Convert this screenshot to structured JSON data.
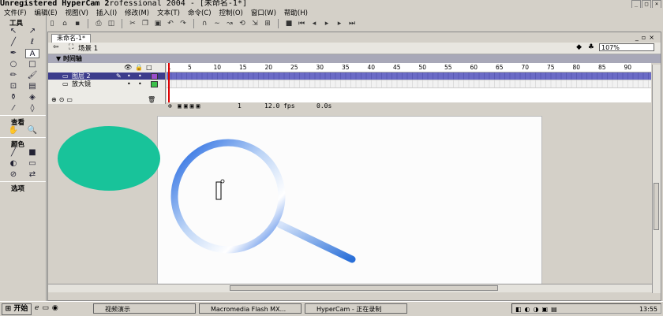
{
  "window": {
    "watermark": "Unregistered HyperCam 2",
    "title_rest": "rofessional 2004 - [未命名-1*]"
  },
  "menu": [
    "文件(F)",
    "编辑(E)",
    "视图(V)",
    "插入(I)",
    "修改(M)",
    "文本(T)",
    "命令(C)",
    "控制(O)",
    "窗口(W)",
    "帮助(H)"
  ],
  "tools_panel": {
    "header": "工具",
    "view_label": "查看",
    "colors_label": "颜色",
    "options_label": "选项"
  },
  "document": {
    "tab": "未命名-1*",
    "scene": "场景 1",
    "zoom": "107%"
  },
  "timeline": {
    "title": "时间轴",
    "layers": [
      {
        "name": "图层 2",
        "color": "#9b4dca"
      },
      {
        "name": "放大镜",
        "color": "#3cc04a"
      }
    ],
    "ruler": [
      "1",
      "5",
      "10",
      "15",
      "20",
      "25",
      "30",
      "35",
      "40",
      "45",
      "50",
      "55",
      "60",
      "65",
      "70",
      "75",
      "80",
      "85",
      "90"
    ],
    "frame": "1",
    "fps": "12.0 fps",
    "time": "0.0s"
  },
  "taskbar": {
    "start": "开始",
    "items": [
      "视频演示",
      "Macromedia Flash MX...",
      "HyperCam - 正在录制"
    ],
    "clock": "13:55"
  },
  "colors": {
    "circle": "#18c39a",
    "lens": "#2a6fd8"
  }
}
